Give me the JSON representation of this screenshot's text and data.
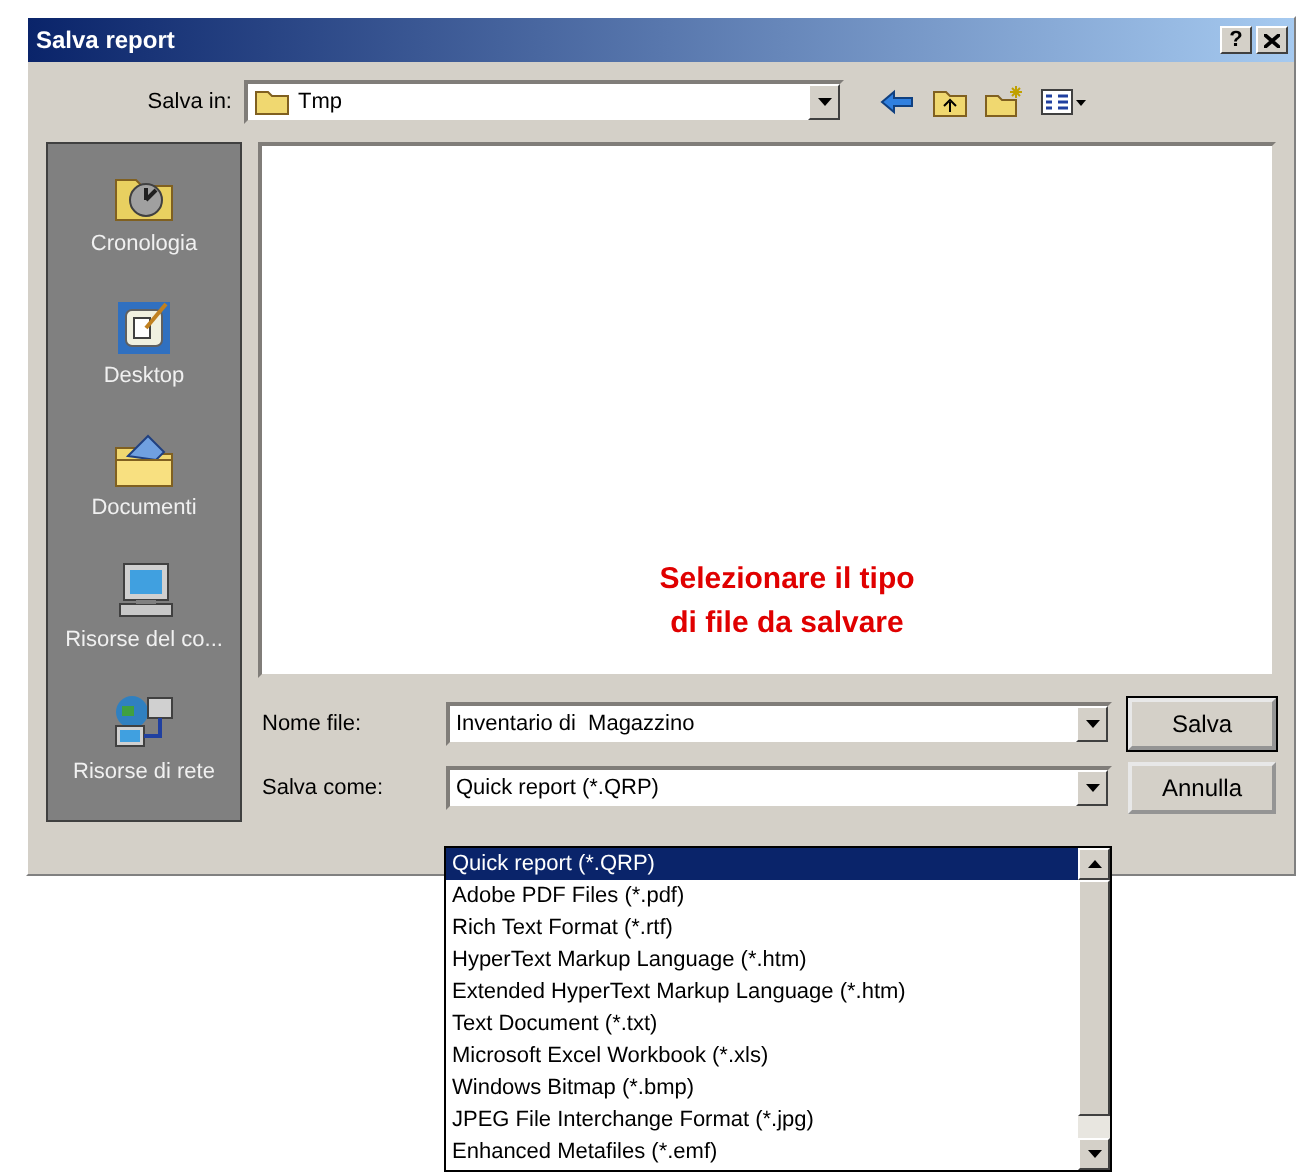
{
  "window": {
    "title": "Salva report",
    "help_button": "?"
  },
  "save_in": {
    "label": "Salva in:",
    "value": "Tmp"
  },
  "places": [
    {
      "label": "Cronologia",
      "kind": "history"
    },
    {
      "label": "Desktop",
      "kind": "desktop"
    },
    {
      "label": "Documenti",
      "kind": "documents"
    },
    {
      "label": "Risorse del co...",
      "kind": "computer"
    },
    {
      "label": "Risorse di rete",
      "kind": "network"
    }
  ],
  "annotation": [
    "Selezionare il tipo",
    "di file da salvare"
  ],
  "file_name": {
    "label": "Nome file:",
    "value": "Inventario di  Magazzino"
  },
  "file_type": {
    "label": "Salva come:",
    "value": "Quick report (*.QRP)"
  },
  "buttons": [
    "Salva",
    "Annulla"
  ],
  "type_list": [
    {
      "label": "Quick report (*.QRP)",
      "selected": true
    },
    {
      "label": "Adobe PDF Files (*.pdf)",
      "selected": false
    },
    {
      "label": "Rich Text Format (*.rtf)",
      "selected": false
    },
    {
      "label": "HyperText Markup Language (*.htm)",
      "selected": false
    },
    {
      "label": "Extended HyperText Markup Language (*.htm)",
      "selected": false
    },
    {
      "label": "Text Document (*.txt)",
      "selected": false
    },
    {
      "label": "Microsoft Excel Workbook (*.xls)",
      "selected": false
    },
    {
      "label": "Windows Bitmap (*.bmp)",
      "selected": false
    },
    {
      "label": "JPEG File Interchange Format (*.jpg)",
      "selected": false
    },
    {
      "label": "Enhanced Metafiles (*.emf)",
      "selected": false
    }
  ]
}
